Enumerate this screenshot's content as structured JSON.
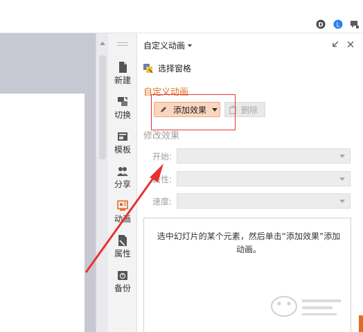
{
  "sidebar": {
    "items": [
      {
        "label": "新建",
        "icon": "new-file-icon"
      },
      {
        "label": "切换",
        "icon": "switch-slides-icon"
      },
      {
        "label": "模板",
        "icon": "template-icon"
      },
      {
        "label": "分享",
        "icon": "share-icon"
      },
      {
        "label": "动画",
        "icon": "animation-icon"
      },
      {
        "label": "属性",
        "icon": "properties-icon"
      },
      {
        "label": "备份",
        "icon": "backup-icon"
      }
    ],
    "active": "动画"
  },
  "pane": {
    "title": "自定义动画",
    "select_pane_label": "选择窗格",
    "section_custom_animation": "自定义动画",
    "add_effect_label": "添加效果",
    "delete_label": "删除",
    "section_modify_effect": "修改效果",
    "start_label": "开始:",
    "property_label": "属性:",
    "speed_label": "速度:",
    "info_text": "选中幻灯片的某个元素，然后单击“添加效果”添加动画。"
  },
  "colors": {
    "accent": "#e36b21",
    "annotation": "#e53333",
    "add_button_bg": "#fad6c0"
  }
}
